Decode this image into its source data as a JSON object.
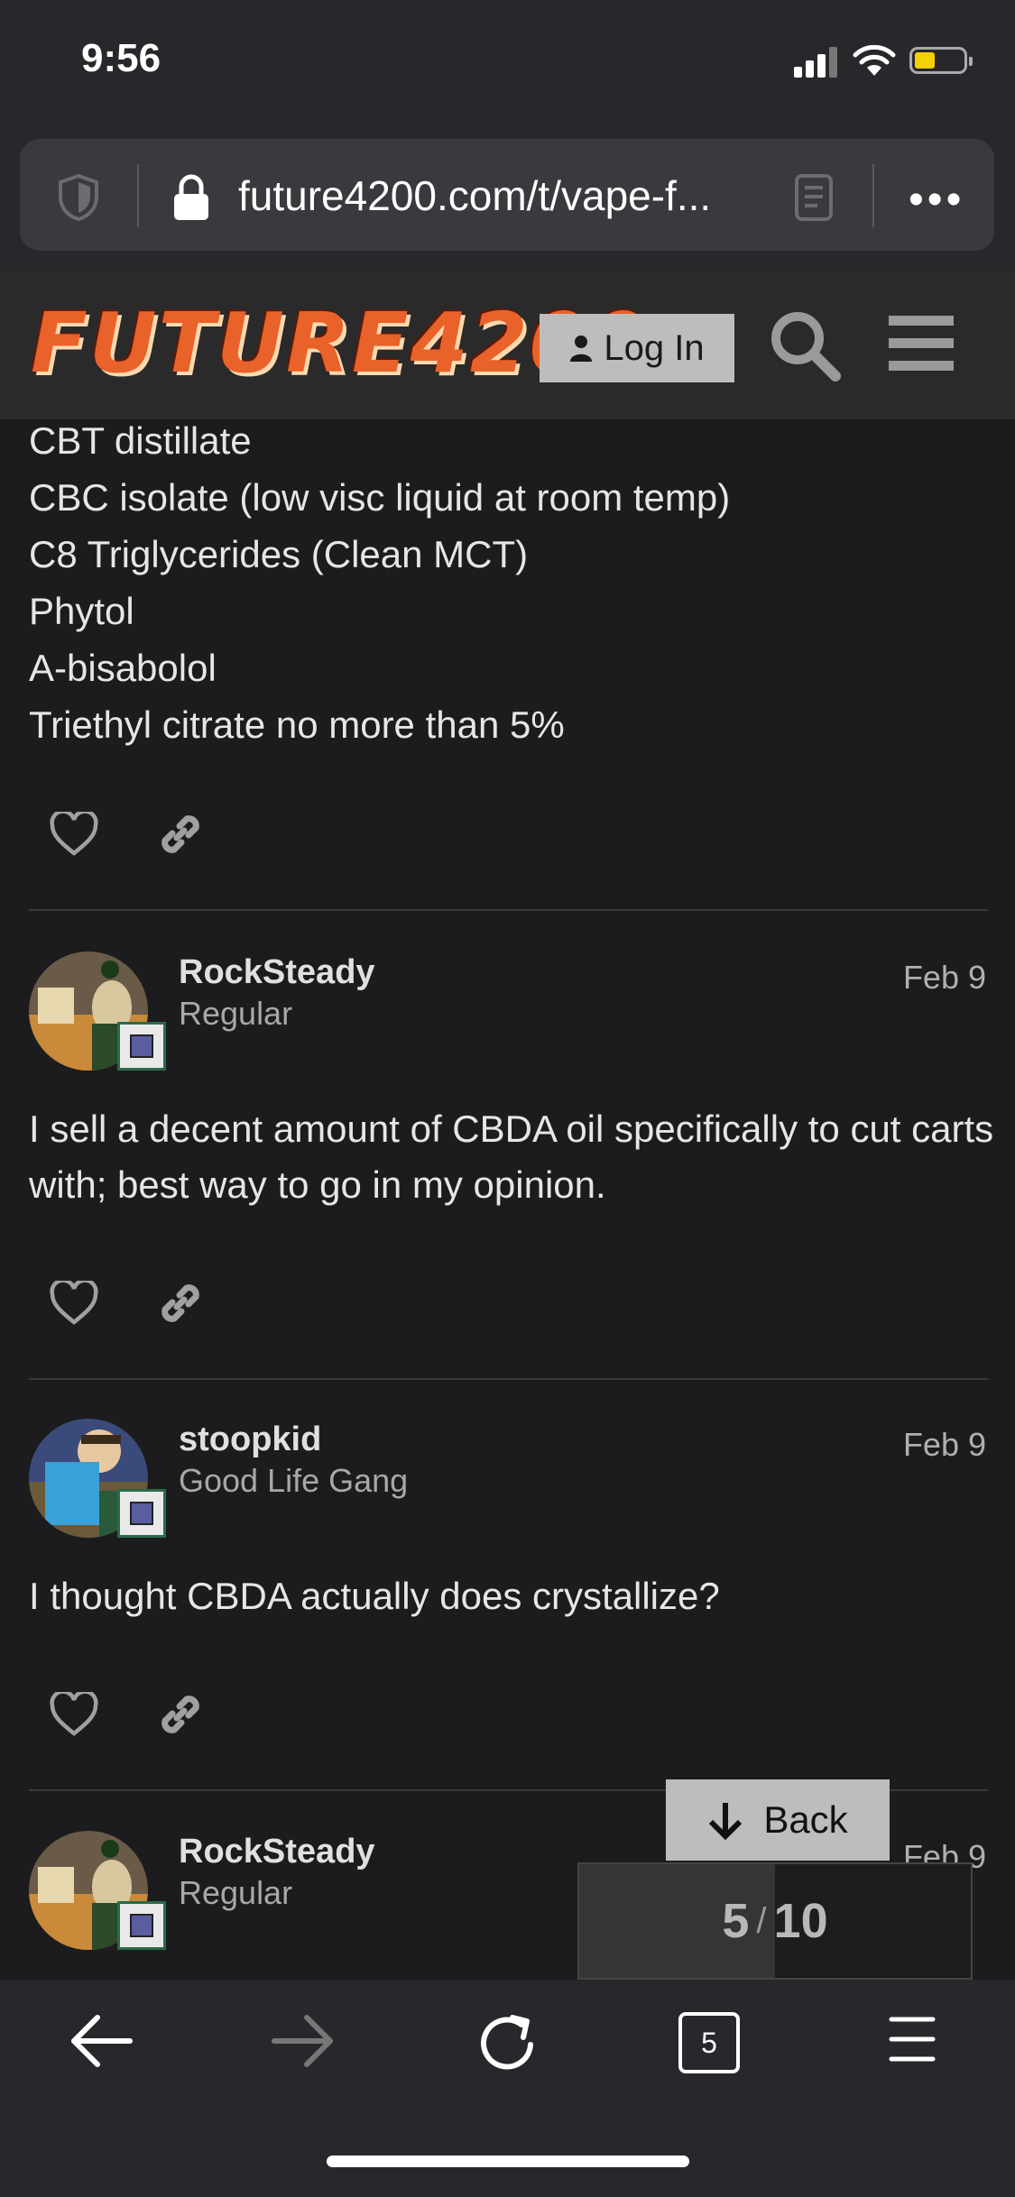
{
  "status": {
    "time": "9:56"
  },
  "browser": {
    "url": "future4200.com/t/vape-f...",
    "tabs_count": "5"
  },
  "header": {
    "logo": "FUTURE4200",
    "login_label": "Log In"
  },
  "post_top": {
    "lines": [
      "CBT distillate",
      "CBC isolate (low visc liquid at room temp)",
      "C8 Triglycerides (Clean MCT)",
      "Phytol",
      "A-bisabolol",
      "Triethyl citrate no more than 5%"
    ]
  },
  "posts": [
    {
      "username": "RockSteady",
      "title": "Regular",
      "date": "Feb 9",
      "text": "I sell a decent amount of CBDA oil specifically to cut carts with; best way to go in my opinion."
    },
    {
      "username": "stoopkid",
      "title": "Good Life Gang",
      "date": "Feb 9",
      "text": "I thought CBDA actually does crystallize?"
    },
    {
      "username": "RockSteady",
      "title": "Regular",
      "date": "Feb 9"
    }
  ],
  "timeline": {
    "back_label": "Back",
    "current": "5",
    "total": "10",
    "progress_fraction": 0.5
  },
  "colors": {
    "background": "#1c1c1e",
    "header": "#2a2a2b",
    "logo_orange": "#e8622a",
    "battery": "#f5d000"
  }
}
